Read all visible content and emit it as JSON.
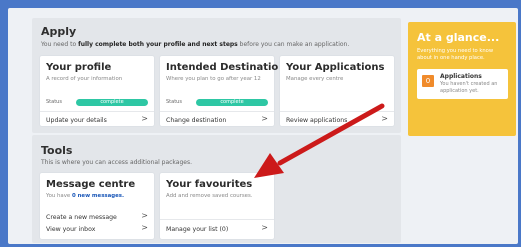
{
  "apply": {
    "title": "Apply",
    "subtitle_pre": "You need to ",
    "subtitle_bold": "fully complete both your profile and next steps",
    "subtitle_post": " before you can make an application.",
    "cards": [
      {
        "title": "Your profile",
        "desc": "A record of your information",
        "status_label": "Status",
        "status_value": "complete",
        "link": "Update your details"
      },
      {
        "title": "Intended Destination",
        "desc": "Where you plan to go after year 12",
        "status_label": "Status",
        "status_value": "complete",
        "link": "Change destination"
      },
      {
        "title": "Your Applications",
        "desc": "Manage every centre",
        "link": "Review applications"
      }
    ]
  },
  "tools": {
    "title": "Tools",
    "subtitle": "This is where you can access additional packages.",
    "message_centre": {
      "title": "Message centre",
      "desc_pre": "You have ",
      "desc_count": "0 new messages.",
      "link1": "Create a new message",
      "link2": "View your inbox"
    },
    "favourites": {
      "title": "Your favourites",
      "desc": "Add and remove saved courses.",
      "link": "Manage your list (0)"
    }
  },
  "glance": {
    "title": "At a glance...",
    "subtitle": "Everything you need to know about in one handy place.",
    "card": {
      "count": "0",
      "title": "Applications",
      "sub": "You haven't created an application yet."
    }
  },
  "chevron": ">",
  "colors": {
    "background": "#4a78c8",
    "status_complete": "#2ec7a4",
    "glance_panel": "#f5c33b",
    "glance_badge": "#f08b2b",
    "arrow": "#cc1a1a",
    "link_blue": "#1a57b8"
  }
}
